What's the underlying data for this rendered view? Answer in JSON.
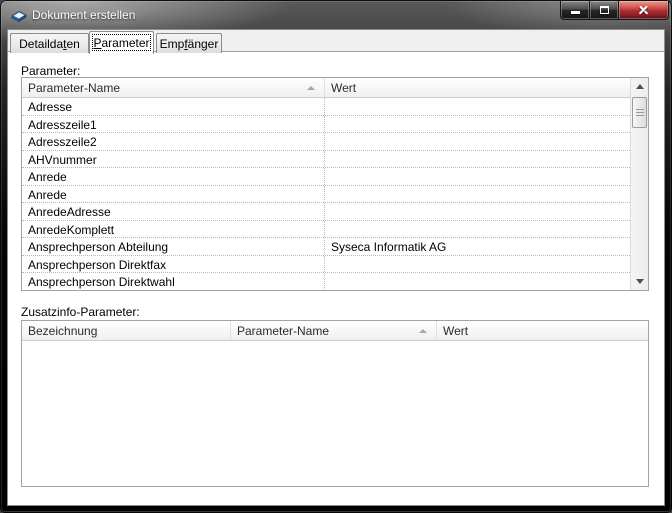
{
  "window": {
    "title": "Dokument erstellen",
    "controls": {
      "minimize": "minimize",
      "maximize": "maximize",
      "close": "close"
    }
  },
  "tabs": [
    {
      "pre": "Detailda",
      "key": "t",
      "post": "en",
      "active": false
    },
    {
      "pre": "",
      "key": "P",
      "post": "arameter",
      "active": true
    },
    {
      "pre": "Emp",
      "key": "f",
      "post": "änger",
      "active": false
    }
  ],
  "parameter_section": {
    "label": "Parameter:",
    "table": {
      "columns": [
        {
          "label": "Parameter-Name",
          "sorted": "asc"
        },
        {
          "label": "Wert"
        }
      ],
      "rows": [
        {
          "name": "Adresse",
          "wert": ""
        },
        {
          "name": "Adresszeile1",
          "wert": ""
        },
        {
          "name": "Adresszeile2",
          "wert": ""
        },
        {
          "name": "AHVnummer",
          "wert": ""
        },
        {
          "name": "Anrede",
          "wert": ""
        },
        {
          "name": "Anrede",
          "wert": ""
        },
        {
          "name": "AnredeAdresse",
          "wert": ""
        },
        {
          "name": "AnredeKomplett",
          "wert": ""
        },
        {
          "name": "Ansprechperson Abteilung",
          "wert": "Syseca Informatik AG"
        },
        {
          "name": "Ansprechperson Direktfax",
          "wert": ""
        },
        {
          "name": "Ansprechperson Direktwahl",
          "wert": ""
        }
      ]
    }
  },
  "zusatzinfo_section": {
    "label": "Zusatzinfo-Parameter:",
    "table": {
      "columns": [
        {
          "label": "Bezeichnung"
        },
        {
          "label": "Parameter-Name",
          "sorted": "asc"
        },
        {
          "label": "Wert"
        }
      ],
      "rows": []
    }
  },
  "colors": {
    "titlebar_base": "#000000",
    "close_button_red": "#a92b30",
    "tab_strip_bg": "#f0f0f0",
    "grid_border": "#a3a3a3",
    "grid_dotted_line": "#b9b9b9"
  }
}
